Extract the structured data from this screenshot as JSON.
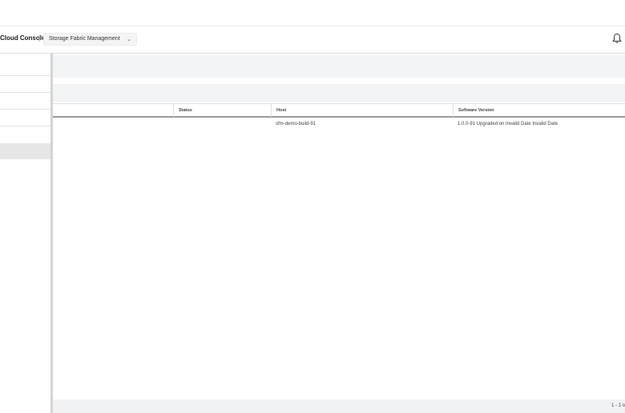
{
  "header": {
    "brand": "Cloud Console",
    "separator": "|",
    "app_selector": "Storage Fabric Management",
    "app_selector_chevron": "chevron-down-icon",
    "notification_icon": "bell-icon"
  },
  "sidebar": {
    "items": [
      {
        "label": ""
      },
      {
        "label": ""
      },
      {
        "label": ""
      },
      {
        "label": ""
      },
      {
        "label": "",
        "active": true
      }
    ]
  },
  "table": {
    "columns": [
      "",
      "Status",
      "Host",
      "Software Version"
    ],
    "rows": [
      {
        "name": "",
        "status": "",
        "host": "sfm-demo-build-91",
        "software_version": "1.0.0-91 Upgraded on Invalid Date Invalid Date"
      }
    ]
  },
  "footer": {
    "pagination": "1 - 1 o"
  },
  "colors": {
    "sidebar_active": "#e6e6e6",
    "band_background": "#f3f4f6",
    "header_rule": "#9a9a9a"
  }
}
